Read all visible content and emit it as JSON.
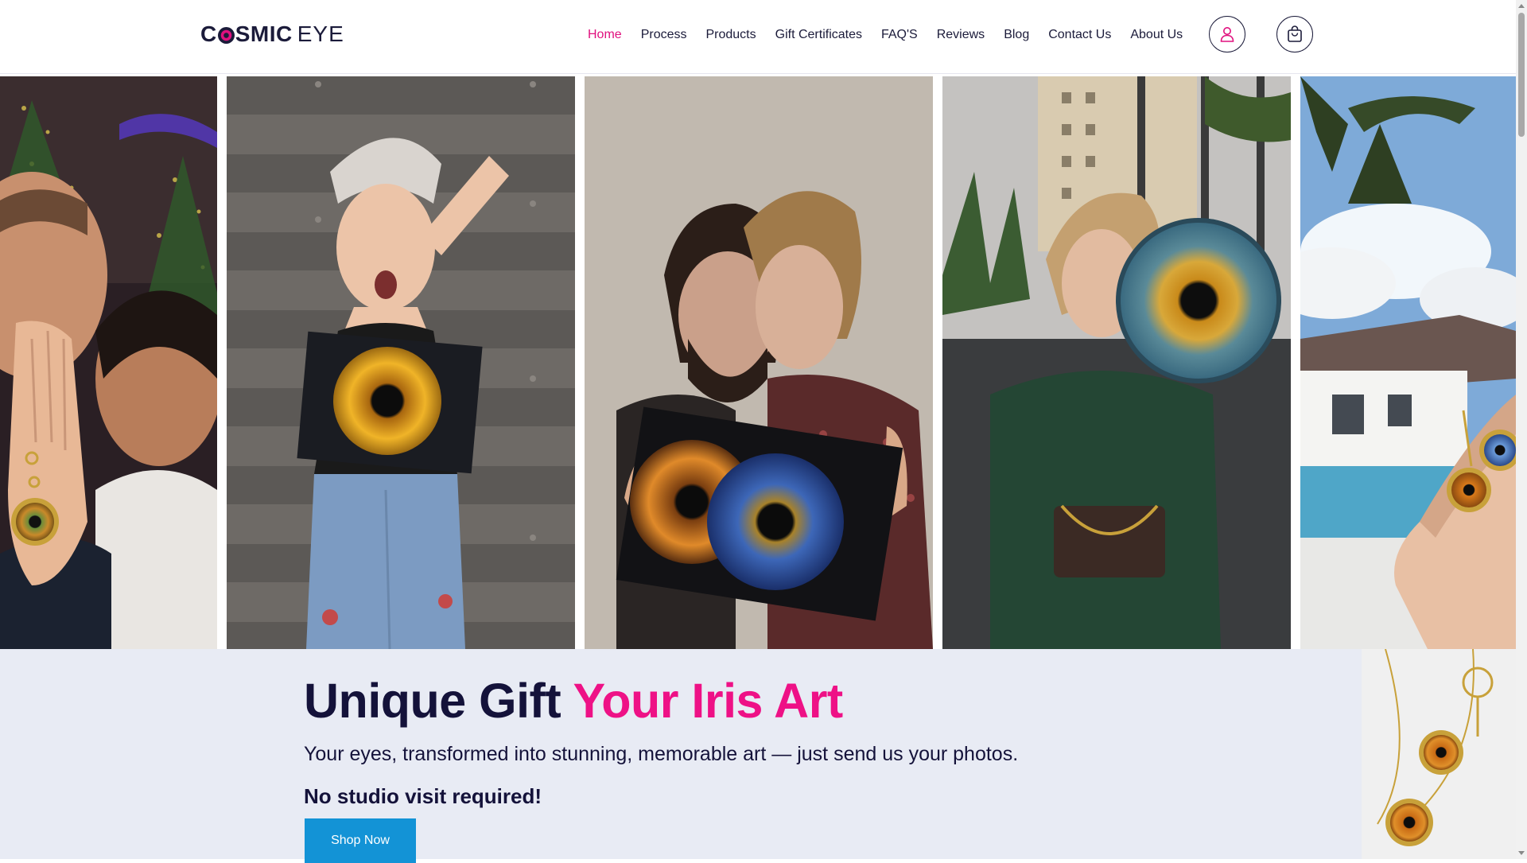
{
  "brand": {
    "logo_bold": "COSMIC",
    "logo_light": "EYE",
    "accent_color": "#e0107e",
    "button_color": "#1393d6"
  },
  "nav": {
    "items": [
      {
        "label": "Home",
        "active": true
      },
      {
        "label": "Process"
      },
      {
        "label": "Products"
      },
      {
        "label": "Gift Certificates"
      },
      {
        "label": "FAQ'S"
      },
      {
        "label": "Reviews"
      },
      {
        "label": "Blog"
      },
      {
        "label": "Contact Us"
      },
      {
        "label": "About Us"
      }
    ],
    "icons": [
      "user-icon",
      "shopping-bag-icon"
    ]
  },
  "gallery": {
    "photos": [
      "couple-with-iris-keychain",
      "woman-with-iris-print",
      "couple-with-infinity-iris-print",
      "woman-with-round-iris-art",
      "hand-with-iris-keychains"
    ]
  },
  "hero": {
    "title_main": "Unique Gift ",
    "title_accent": "Your Iris Art",
    "subtitle": "Your eyes, transformed into stunning, memorable art — just send us your photos.",
    "note": "No studio visit required!",
    "cta_label": "Shop Now"
  }
}
